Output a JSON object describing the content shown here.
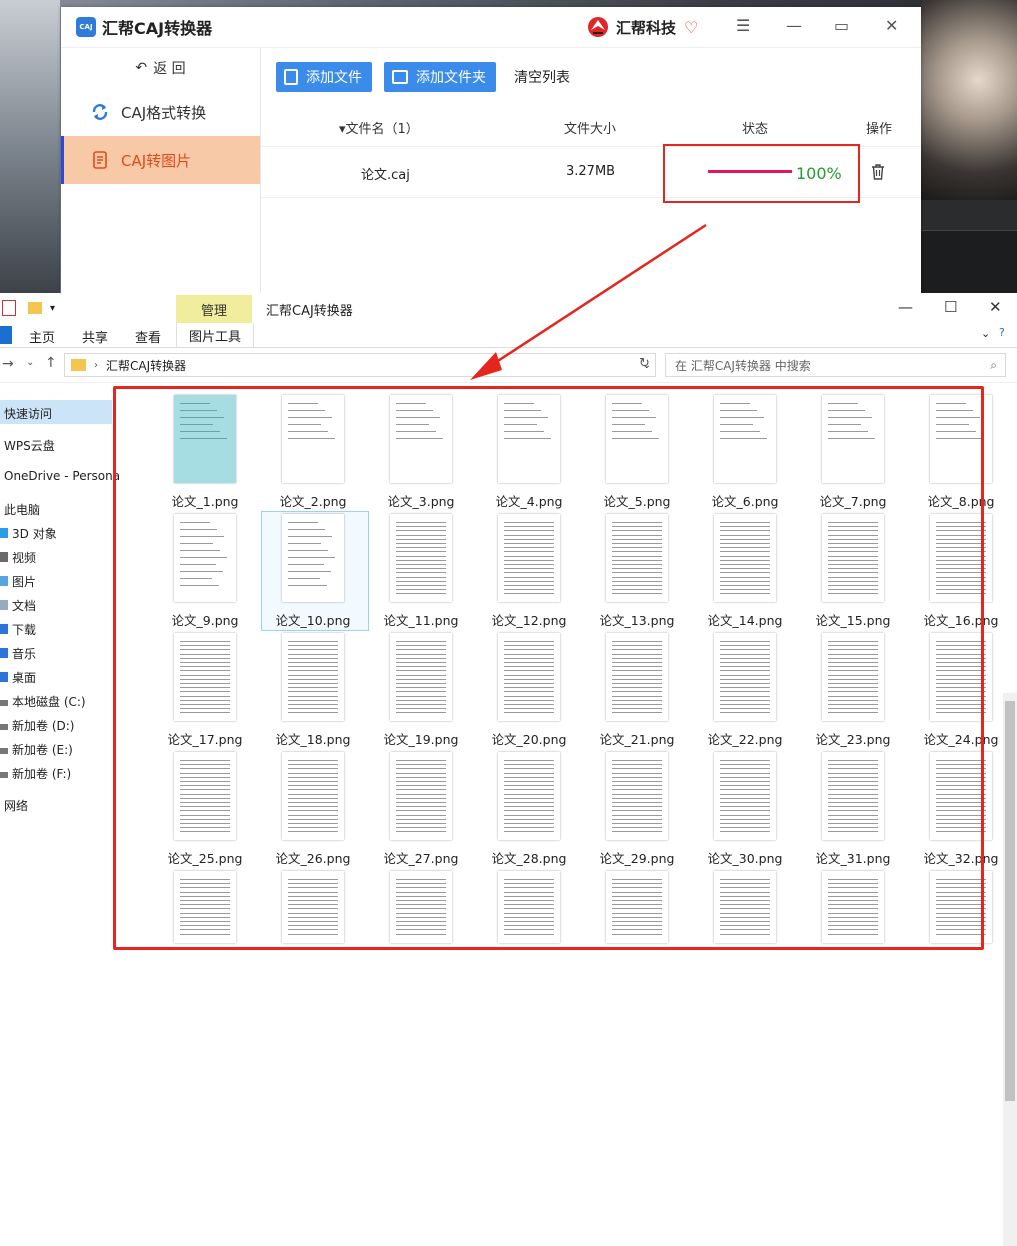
{
  "app": {
    "title": "汇帮CAJ转换器",
    "logo_text": "CAJ",
    "brand": "汇帮科技",
    "back_label": "返 回",
    "sidebar": [
      {
        "label": "CAJ格式转换",
        "active": false
      },
      {
        "label": "CAJ转图片",
        "active": true
      }
    ],
    "toolbar": {
      "add_file": "添加文件",
      "add_folder": "添加文件夹",
      "clear_list": "清空列表"
    },
    "table": {
      "col_name": "文件名（1）",
      "col_size": "文件大小",
      "col_status": "状态",
      "col_action": "操作",
      "row": {
        "name": "论文.caj",
        "size": "3.27MB",
        "progress": 100,
        "progress_label": "100%"
      }
    },
    "colors": {
      "accent": "#3b8bea",
      "active_bg": "#f8c9a6",
      "active_text": "#e24a1c",
      "progress": "#e0185c",
      "percent": "#1f9d2f",
      "highlight": "#e5261f"
    }
  },
  "explorer": {
    "context_tab": "管理",
    "window_title": "汇帮CAJ转换器",
    "ribbon": [
      "主页",
      "共享",
      "查看",
      "图片工具"
    ],
    "address": "汇帮CAJ转换器",
    "search_placeholder": "在 汇帮CAJ转换器 中搜索",
    "nav": [
      "快速访问",
      "WPS云盘",
      "OneDrive - Persona",
      "此电脑",
      "3D 对象",
      "视频",
      "图片",
      "文档",
      "下载",
      "音乐",
      "桌面",
      "本地磁盘 (C:)",
      "新加卷 (D:)",
      "新加卷 (E:)",
      "新加卷 (F:)",
      "网络"
    ],
    "files": [
      "论文_1.png",
      "论文_2.png",
      "论文_3.png",
      "论文_4.png",
      "论文_5.png",
      "论文_6.png",
      "论文_7.png",
      "论文_8.png",
      "论文_9.png",
      "论文_10.png",
      "论文_11.png",
      "论文_12.png",
      "论文_13.png",
      "论文_14.png",
      "论文_15.png",
      "论文_16.png",
      "论文_17.png",
      "论文_18.png",
      "论文_19.png",
      "论文_20.png",
      "论文_21.png",
      "论文_22.png",
      "论文_23.png",
      "论文_24.png",
      "论文_25.png",
      "论文_26.png",
      "论文_27.png",
      "论文_28.png",
      "论文_29.png",
      "论文_30.png",
      "论文_31.png",
      "论文_32.png"
    ],
    "selected_file": "论文_10.png"
  }
}
